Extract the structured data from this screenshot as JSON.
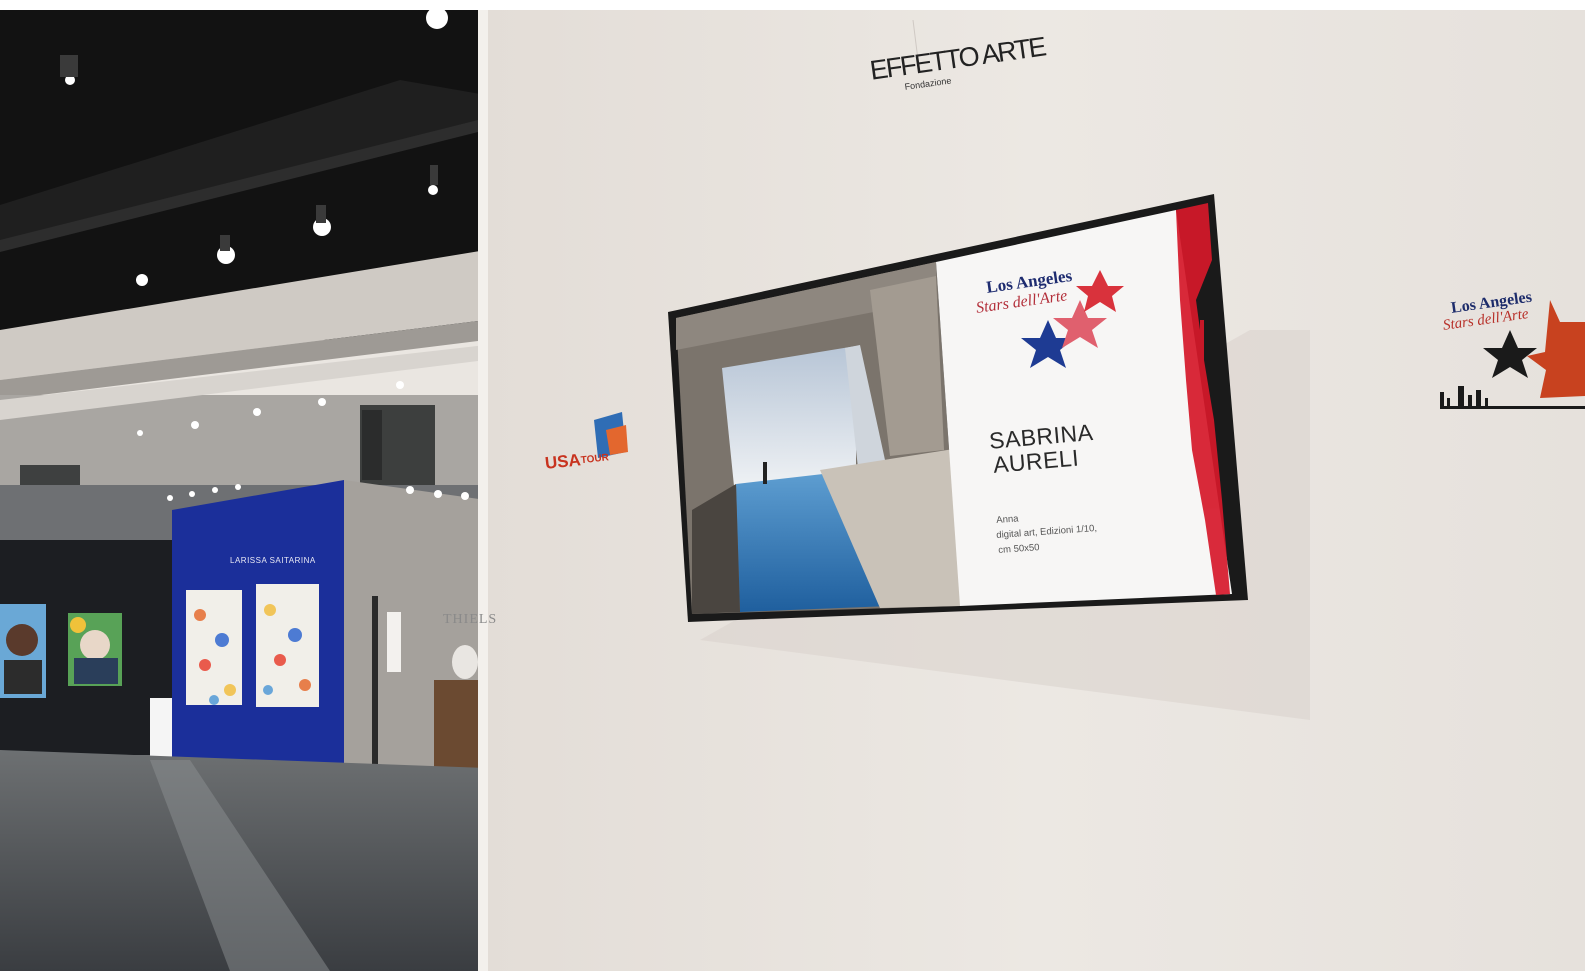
{
  "effetto_arte": {
    "title": "EFFETTO ARTE",
    "subtitle": "Fondazione"
  },
  "usa_tour_sticker": {
    "usa": "USA",
    "tour": "TOUR"
  },
  "la_sticker_right": {
    "title": "Los Angeles",
    "script": "Stars dell'Arte"
  },
  "tv": {
    "logo_title": "Los Angeles",
    "logo_script": "Stars dell'Arte",
    "artist_first": "SABRINA",
    "artist_last": "AURELI",
    "work_title": "Anna",
    "work_medium": "digital art, Edizioni 1/10,",
    "work_size": "cm 50x50"
  },
  "booth": {
    "sign": "LARISSA SAITARINA",
    "thiels": "THIELS"
  },
  "colors": {
    "wall": "#eae6e1",
    "booth_blue": "#1b2f9a",
    "ceiling": "#151515",
    "tv_bezel": "#1a1a1a",
    "star_blue": "#1e3b93",
    "star_red": "#d9323c"
  }
}
